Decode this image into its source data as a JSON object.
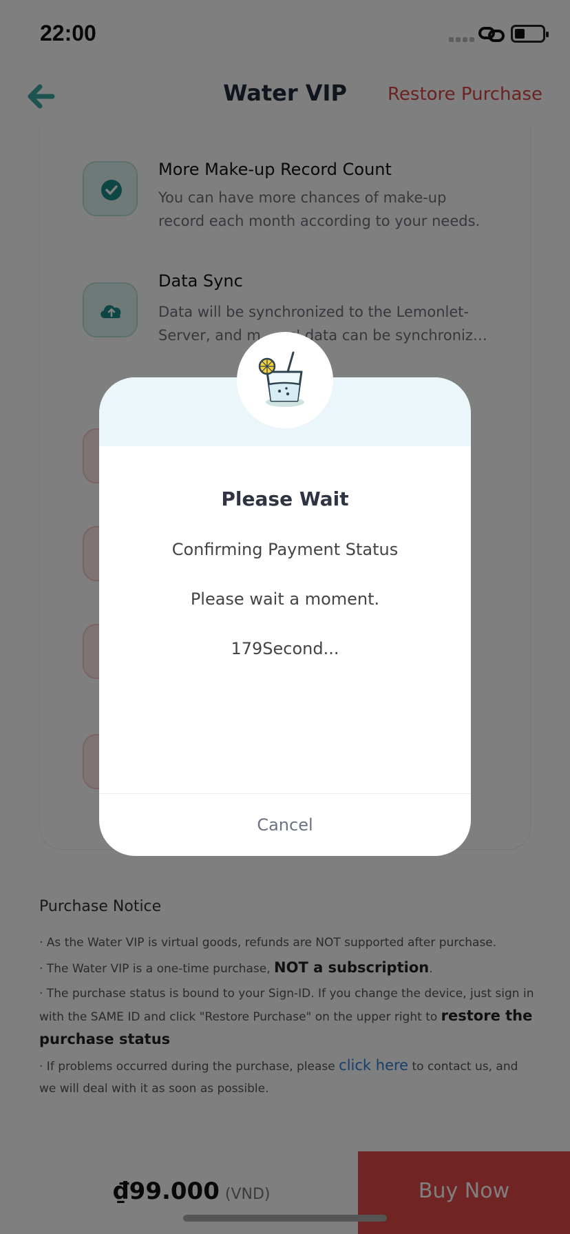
{
  "status_bar": {
    "time": "22:00"
  },
  "nav": {
    "title": "Water VIP",
    "restore_label": "Restore Purchase"
  },
  "features": [
    {
      "title": "More Make-up Record Count",
      "desc": "You can have more chances of make-up record each month according to your needs.",
      "icon": "check-icon"
    },
    {
      "title": "Data Sync",
      "desc": "Data will be synchronized to the Lemonlet-Server, and m… es' data can be synchroniz…",
      "icon": "cloud-upload-icon"
    }
  ],
  "notice": {
    "title": "Purchase Notice",
    "item1": "· As the Water VIP is virtual goods, refunds are NOT supported after purchase.",
    "item2_a": "· The Water VIP is a one-time purchase, ",
    "item2_b": "NOT a subscription",
    "item2_c": ".",
    "item3_a": "· The purchase status is bound to your Sign-ID. If you change the device, just sign in with the SAME ID and click \"Restore Purchase\" on the upper right to ",
    "item3_b": "restore the purchase status",
    "item4_a": "· If problems occurred during the purchase, please ",
    "item4_link": "click here",
    "item4_b": " to contact us, and we will deal with it as soon as possible."
  },
  "bottom": {
    "price": "₫99.000",
    "currency": "(VND)",
    "buy_label": "Buy Now"
  },
  "dialog": {
    "icon": "drink-glass-icon",
    "title": "Please Wait",
    "line1": "Confirming Payment Status",
    "line2": "Please wait a moment.",
    "line3": "179Second...",
    "cancel_label": "Cancel"
  },
  "colors": {
    "accent_red": "#e04a48",
    "teal": "#1c8c86",
    "link_blue": "#2a7fd4"
  }
}
